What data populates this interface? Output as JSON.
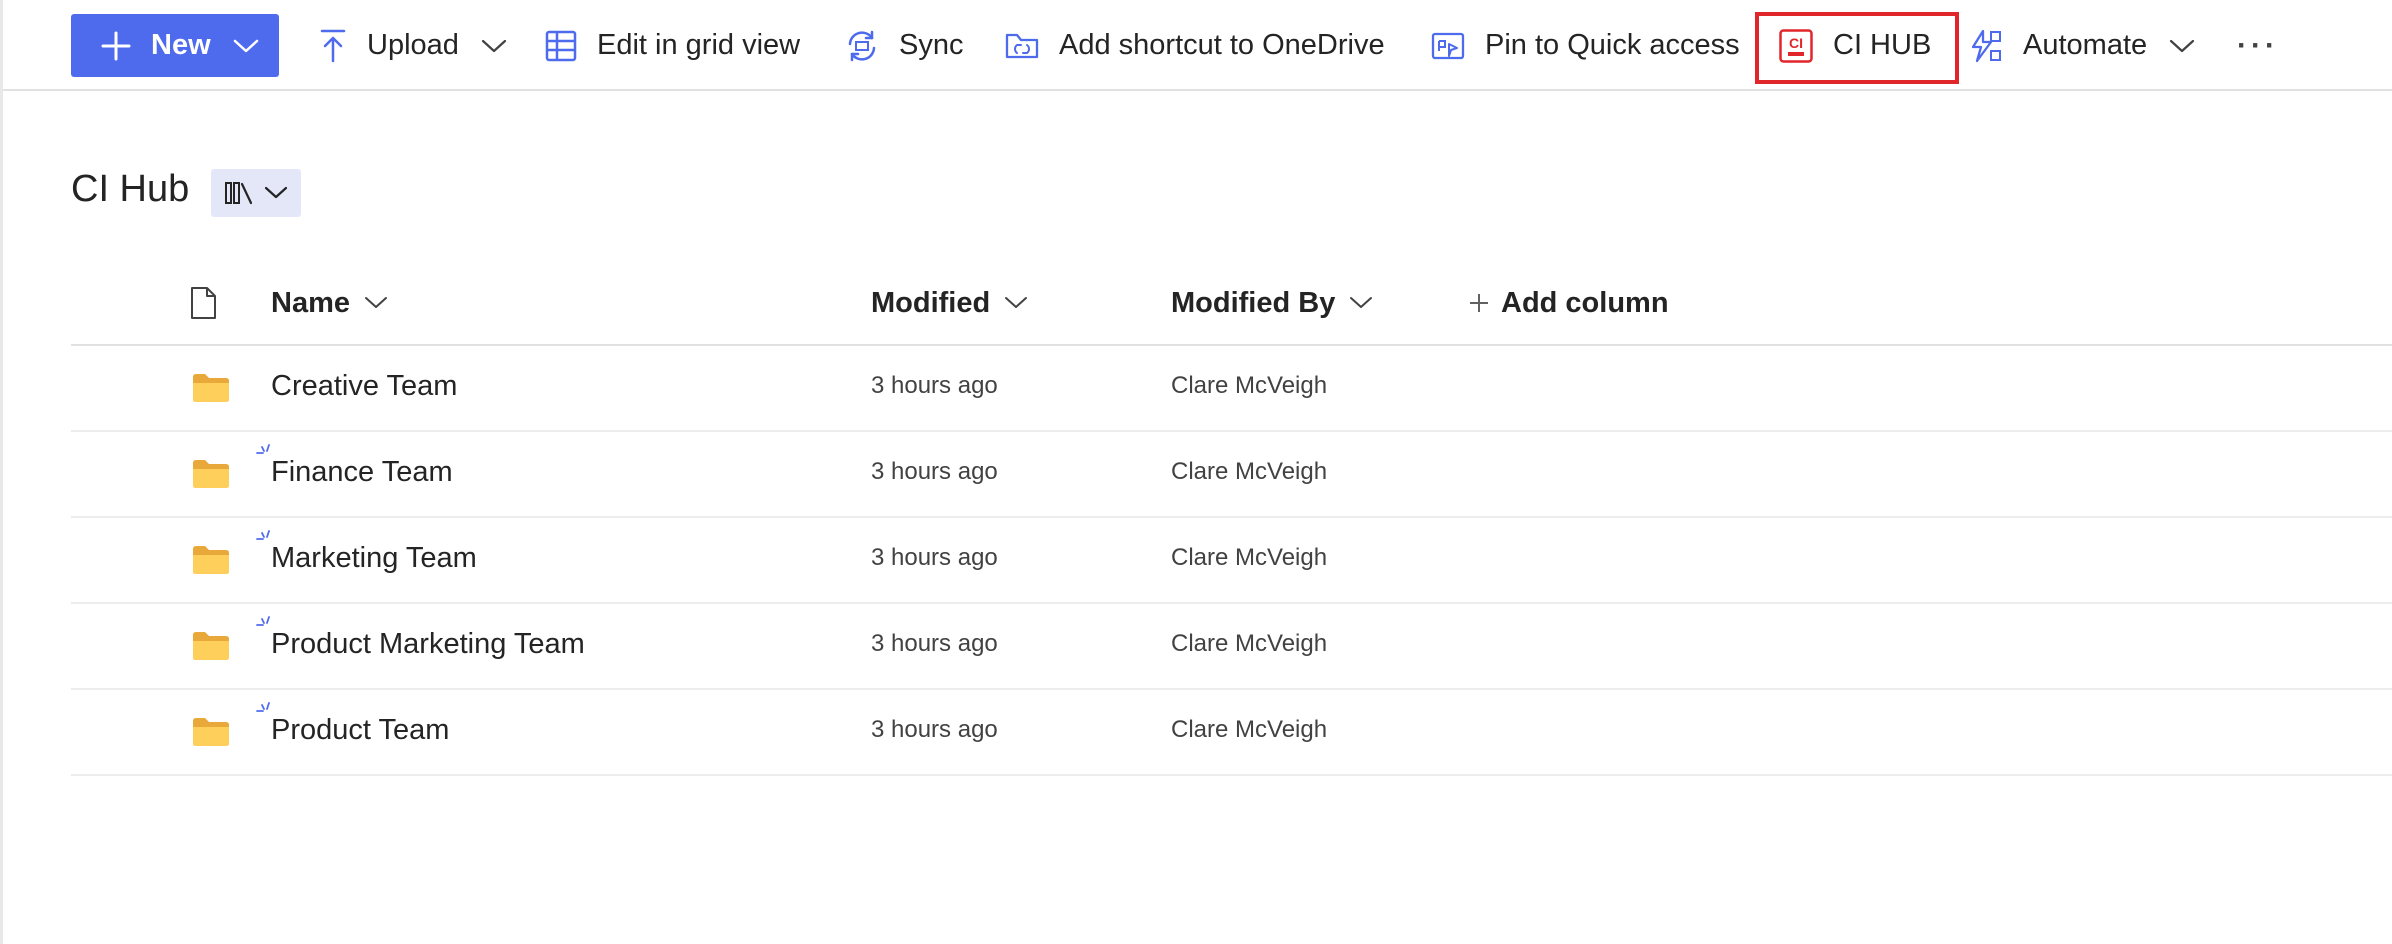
{
  "command_bar": {
    "new_label": "New",
    "upload_label": "Upload",
    "edit_grid_label": "Edit in grid view",
    "sync_label": "Sync",
    "add_shortcut_label": "Add shortcut to OneDrive",
    "pin_quick_access_label": "Pin to Quick access",
    "ci_hub_label": "CI HUB",
    "ci_hub_logo_text": "CI",
    "automate_label": "Automate",
    "more_label": "···",
    "accent_color": "#4f6bed",
    "highlight_color": "#e0262a"
  },
  "library": {
    "title": "CI Hub"
  },
  "columns": {
    "name": "Name",
    "modified": "Modified",
    "modified_by": "Modified By",
    "add_column": "Add column"
  },
  "rows": [
    {
      "icon": "folder-icon",
      "name": "Creative Team",
      "modified": "3 hours ago",
      "modified_by": "Clare McVeigh",
      "is_new": false
    },
    {
      "icon": "folder-icon",
      "name": "Finance Team",
      "modified": "3 hours ago",
      "modified_by": "Clare McVeigh",
      "is_new": true
    },
    {
      "icon": "folder-icon",
      "name": "Marketing Team",
      "modified": "3 hours ago",
      "modified_by": "Clare McVeigh",
      "is_new": true
    },
    {
      "icon": "folder-icon",
      "name": "Product Marketing Team",
      "modified": "3 hours ago",
      "modified_by": "Clare McVeigh",
      "is_new": true
    },
    {
      "icon": "folder-icon",
      "name": "Product Team",
      "modified": "3 hours ago",
      "modified_by": "Clare McVeigh",
      "is_new": true
    }
  ]
}
